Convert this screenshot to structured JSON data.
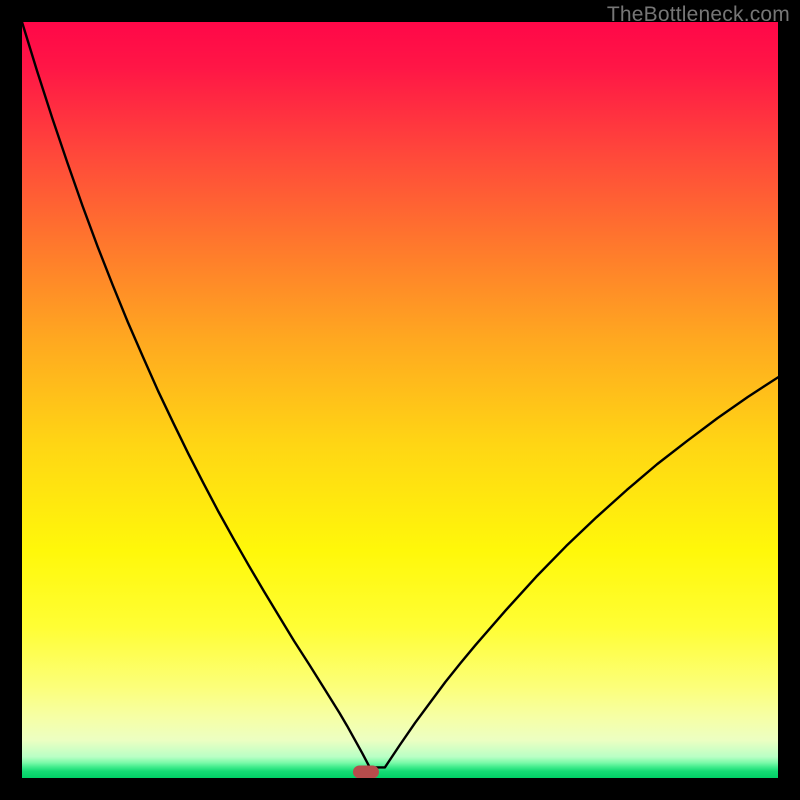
{
  "watermark": "TheBottleneck.com",
  "chart_data": {
    "type": "line",
    "title": "",
    "xlabel": "",
    "ylabel": "",
    "x": [
      0.0,
      0.02,
      0.04,
      0.06,
      0.08,
      0.1,
      0.12,
      0.14,
      0.16,
      0.18,
      0.2,
      0.22,
      0.24,
      0.26,
      0.28,
      0.3,
      0.32,
      0.34,
      0.36,
      0.38,
      0.4,
      0.41,
      0.42,
      0.43,
      0.44,
      0.45,
      0.46,
      0.48,
      0.5,
      0.52,
      0.54,
      0.56,
      0.58,
      0.6,
      0.64,
      0.68,
      0.72,
      0.76,
      0.8,
      0.84,
      0.88,
      0.92,
      0.96,
      1.0
    ],
    "y": [
      1.0,
      0.935,
      0.873,
      0.814,
      0.757,
      0.703,
      0.652,
      0.603,
      0.557,
      0.512,
      0.47,
      0.429,
      0.39,
      0.352,
      0.316,
      0.281,
      0.247,
      0.214,
      0.181,
      0.15,
      0.118,
      0.102,
      0.086,
      0.069,
      0.051,
      0.033,
      0.014,
      0.014,
      0.044,
      0.073,
      0.1,
      0.127,
      0.152,
      0.176,
      0.222,
      0.266,
      0.307,
      0.345,
      0.381,
      0.415,
      0.446,
      0.476,
      0.504,
      0.53
    ],
    "xlim": [
      0,
      1
    ],
    "ylim": [
      0,
      1
    ],
    "marker": {
      "x": 0.455,
      "y": 0.008,
      "shape": "pill",
      "color": "#b74c4c"
    },
    "background": "radial-gradient red-yellow-green",
    "grid": false,
    "legend": false
  }
}
